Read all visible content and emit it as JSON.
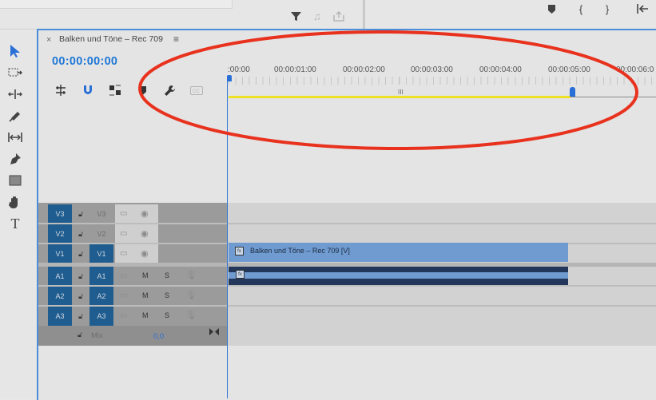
{
  "top_bar": {
    "icons": [
      "filter-icon",
      "music-note-icon",
      "export-icon",
      "marker-icon",
      "in-point-icon",
      "out-point-icon",
      "go-to-in-icon"
    ]
  },
  "tools": [
    "selection-tool-icon",
    "track-select-tool-icon",
    "ripple-edit-tool-icon",
    "razor-tool-icon",
    "slip-tool-icon",
    "pen-tool-icon",
    "rectangle-tool-icon",
    "hand-tool-icon",
    "type-tool-icon"
  ],
  "sequence": {
    "close_glyph": "×",
    "title": "Balken und Töne – Rec 709",
    "menu_glyph": "≡",
    "timecode": "00:00:00:00"
  },
  "ruler": {
    "labels": [
      ":00:00",
      "00:00:01:00",
      "00:00:02:00",
      "00:00:03:00",
      "00:00:04:00",
      "00:00:05:00",
      "00:00:06:0"
    ],
    "center_glyph": "III"
  },
  "tracks": {
    "video": [
      {
        "target": "V3",
        "source": "V3",
        "source_on": false
      },
      {
        "target": "V2",
        "source": "V2",
        "source_on": false
      },
      {
        "target": "V1",
        "source": "V1",
        "source_on": true
      }
    ],
    "audio": [
      {
        "target": "A1",
        "source": "A1",
        "mute": "M",
        "solo": "S"
      },
      {
        "target": "A2",
        "source": "A2",
        "mute": "M",
        "solo": "S"
      },
      {
        "target": "A3",
        "source": "A3",
        "mute": "M",
        "solo": "S"
      }
    ],
    "mix": {
      "label": "Mix",
      "value": "0,0"
    }
  },
  "clips": {
    "video": {
      "label": "Balken und Töne – Rec 709 [V]",
      "fx": "fx"
    },
    "audio": {
      "fx": "fx"
    }
  },
  "colors": {
    "timecode": "#1e78d7",
    "target_active": "#1f5c8f",
    "video_clip": "#6f9bd1",
    "audio_clip": "#23375a",
    "work_area": "#efe026",
    "annotation": "#e8321e"
  }
}
